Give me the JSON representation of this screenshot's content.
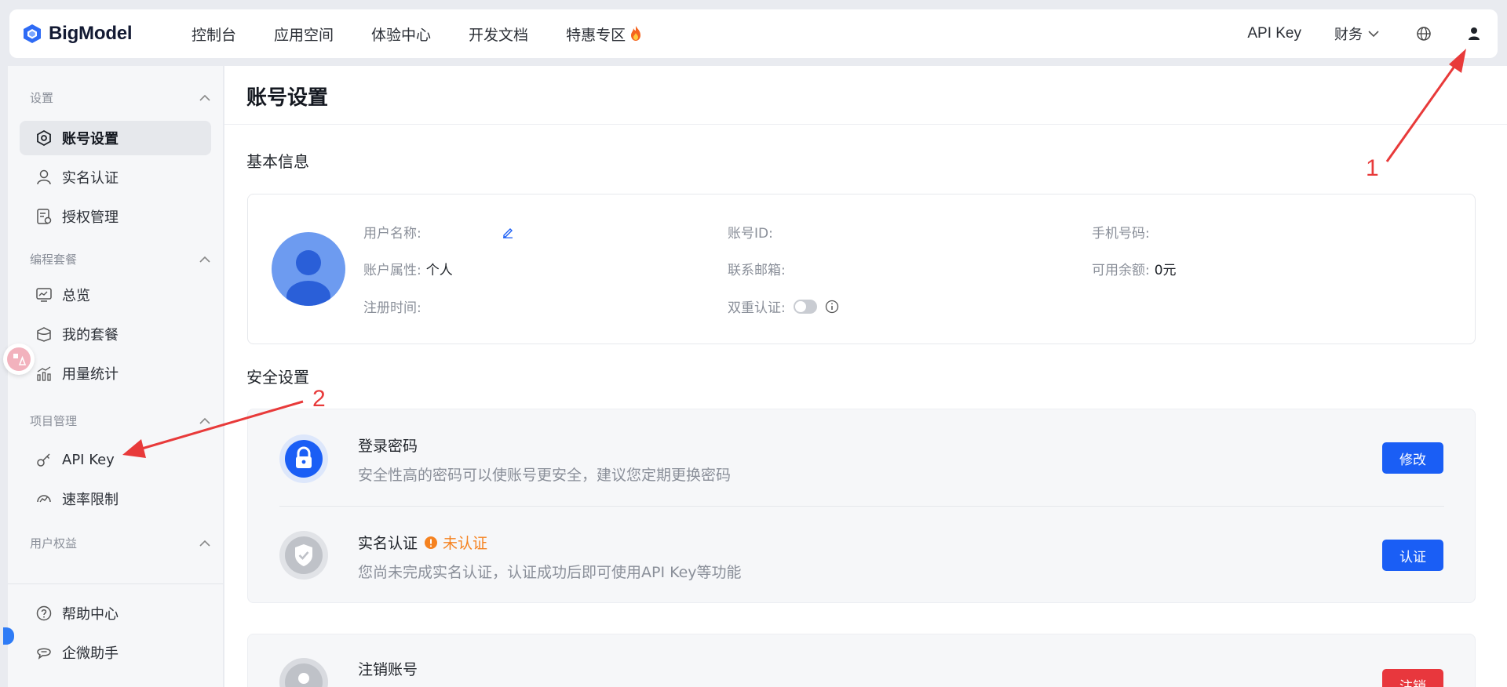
{
  "brand": {
    "name": "BigModel",
    "accent": "#1a5ef5"
  },
  "topnav": {
    "items": [
      {
        "label": "控制台"
      },
      {
        "label": "应用空间"
      },
      {
        "label": "体验中心"
      },
      {
        "label": "开发文档"
      },
      {
        "label": "特惠专区",
        "icon": "fire-icon"
      }
    ],
    "api_key": "API Key",
    "finance": "财务",
    "globe_icon": "globe-icon",
    "user_icon": "user-icon"
  },
  "sidebar": {
    "groups": [
      {
        "label": "设置",
        "items": [
          {
            "label": "账号设置",
            "icon": "settings-icon",
            "active": true
          },
          {
            "label": "实名认证",
            "icon": "person-icon"
          },
          {
            "label": "授权管理",
            "icon": "auth-doc-icon"
          }
        ]
      },
      {
        "label": "编程套餐",
        "items": [
          {
            "label": "总览",
            "icon": "monitor-icon"
          },
          {
            "label": "我的套餐",
            "icon": "package-icon"
          },
          {
            "label": "用量统计",
            "icon": "stats-icon"
          }
        ]
      },
      {
        "label": "项目管理",
        "items": [
          {
            "label": "API Key",
            "icon": "key-icon"
          },
          {
            "label": "速率限制",
            "icon": "gauge-icon"
          }
        ]
      },
      {
        "label": "用户权益",
        "items": []
      }
    ],
    "footer": [
      {
        "label": "帮助中心",
        "icon": "help-icon"
      },
      {
        "label": "企微助手",
        "icon": "chat-icon"
      }
    ]
  },
  "page": {
    "title": "账号设置",
    "basic_info": {
      "heading": "基本信息",
      "username_label": "用户名称:",
      "account_id_label": "账号ID:",
      "phone_label": "手机号码:",
      "account_type_label": "账户属性:",
      "account_type_value": "个人",
      "email_label": "联系邮箱:",
      "balance_label": "可用余额:",
      "balance_value": "0元",
      "register_label": "注册时间:",
      "twofa_label": "双重认证:"
    },
    "security": {
      "heading": "安全设置",
      "password": {
        "title": "登录密码",
        "desc": "安全性高的密码可以使账号更安全，建议您定期更换密码",
        "button": "修改"
      },
      "realname": {
        "title": "实名认证",
        "status": "未认证",
        "desc": "您尚未完成实名认证，认证成功后即可使用API Key等功能",
        "button": "认证"
      }
    },
    "cancel_account": {
      "title": "注销账号",
      "button": "注销"
    }
  },
  "annotations": {
    "one": "1",
    "two": "2"
  },
  "colors": {
    "annotation": "#e83a3a",
    "warning": "#f58220",
    "danger": "#e8373d"
  }
}
